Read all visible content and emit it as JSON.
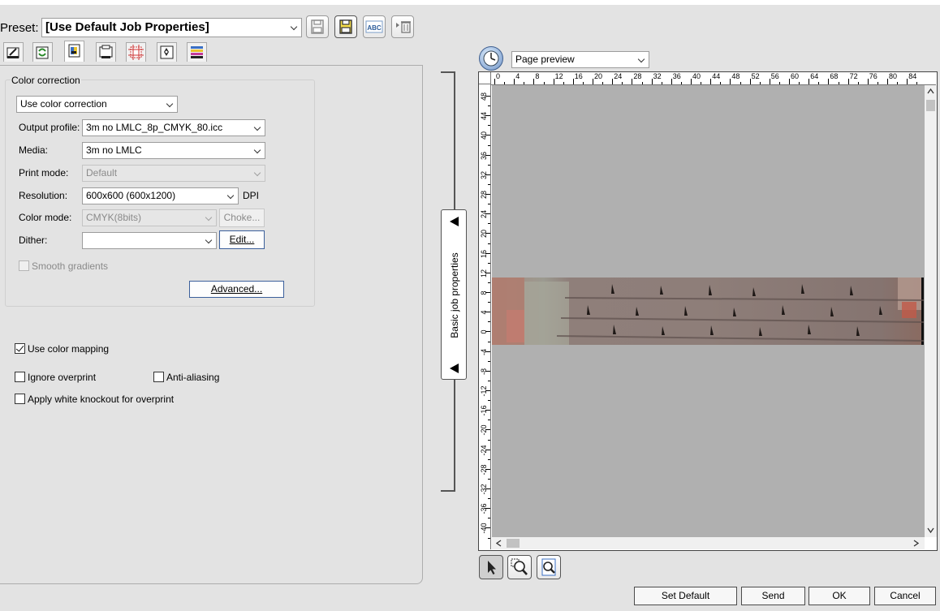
{
  "preset": {
    "label": "Preset:",
    "value": "[Use Default Job Properties]"
  },
  "toolbar_icons": [
    "save-icon",
    "save-as-icon",
    "rename-icon",
    "delete-icon"
  ],
  "toolbar_abc": "ABC",
  "tabs": [
    "print-settings-icon",
    "layout-icon",
    "color-icon",
    "media-icon",
    "marks-icon",
    "cut-icon",
    "color-bars-icon"
  ],
  "color_correction": {
    "group_title": "Color correction",
    "mode": "Use color correction",
    "output_profile_label": "Output profile:",
    "output_profile": "3m no LMLC_8p_CMYK_80.icc",
    "media_label": "Media:",
    "media": "3m no LMLC",
    "print_mode_label": "Print mode:",
    "print_mode": "Default",
    "resolution_label": "Resolution:",
    "resolution": "600x600 (600x1200)",
    "dpi_label": "DPI",
    "color_mode_label": "Color mode:",
    "color_mode": "CMYK(8bits)",
    "choke_label": "Choke...",
    "dither_label": "Dither:",
    "dither": "",
    "edit_label": "Edit...",
    "smooth_gradients_label": "Smooth gradients",
    "smooth_gradients_checked": false,
    "advanced_label": "Advanced..."
  },
  "options": {
    "use_color_mapping_label": "Use color mapping",
    "use_color_mapping_checked": true,
    "ignore_overprint_label": "Ignore overprint",
    "ignore_overprint_checked": false,
    "anti_aliasing_label": "Anti-aliasing",
    "anti_aliasing_checked": false,
    "white_knockout_label": "Apply white knockout for overprint",
    "white_knockout_checked": false
  },
  "side_tab": {
    "label": "Basic job properties"
  },
  "preview": {
    "mode": "Page preview",
    "h_ruler": [
      "0",
      "4",
      "8",
      "12",
      "16",
      "20",
      "24",
      "28",
      "32",
      "36",
      "40",
      "44",
      "48",
      "52",
      "56",
      "60",
      "64",
      "68",
      "72",
      "76",
      "80",
      "84"
    ],
    "v_ruler": [
      "48",
      "44",
      "40",
      "36",
      "32",
      "28",
      "24",
      "20",
      "16",
      "12",
      "8",
      "4",
      "0",
      "-4",
      "-8",
      "-12",
      "-16",
      "-20",
      "-24",
      "-28",
      "-32",
      "-36",
      "-40"
    ],
    "tools": [
      "select-arrow-icon",
      "zoom-area-icon",
      "zoom-fit-icon"
    ],
    "colors": {
      "background": "#b0b0b0",
      "ruler": "#ffffff"
    }
  },
  "footer": {
    "set_default": "Set Default",
    "send": "Send",
    "ok": "OK",
    "cancel": "Cancel"
  }
}
